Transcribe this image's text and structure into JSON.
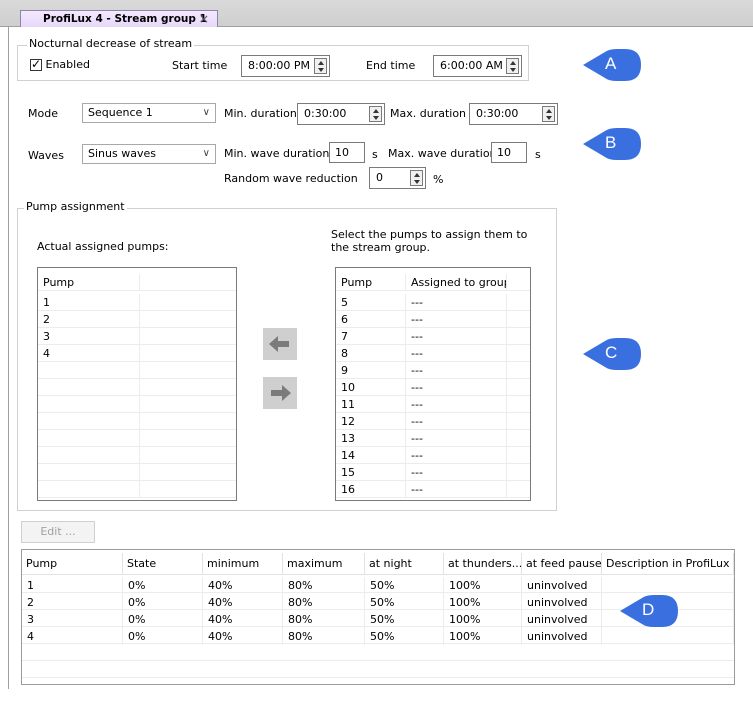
{
  "tab": {
    "title": "ProfiLux 4 - Stream group 1",
    "close": "×"
  },
  "nocturnal": {
    "legend": "Nocturnal decrease of stream",
    "enabled_label": "Enabled",
    "start_label": "Start time",
    "start_value": "8:00:00 PM",
    "end_label": "End time",
    "end_value": "6:00:00 AM"
  },
  "mode": {
    "label": "Mode",
    "value": "Sequence 1",
    "min_label": "Min. duration",
    "min_value": "0:30:00",
    "max_label": "Max. duration",
    "max_value": "0:30:00"
  },
  "waves": {
    "label": "Waves",
    "value": "Sinus waves",
    "min_label": "Min. wave duration",
    "min_value": "10",
    "min_unit": "s",
    "max_label": "Max. wave duration",
    "max_value": "10",
    "max_unit": "s",
    "random_label": "Random wave reduction",
    "random_value": "0",
    "random_unit": "%"
  },
  "pump_assignment": {
    "legend": "Pump assignment",
    "assigned_label": "Actual assigned pumps:",
    "select_label": "Select the pumps to assign them to the stream group.",
    "assigned_header": "Pump",
    "assigned": [
      "1",
      "2",
      "3",
      "4"
    ],
    "available_headers": [
      "Pump",
      "Assigned to group"
    ],
    "available": [
      [
        "5",
        "---"
      ],
      [
        "6",
        "---"
      ],
      [
        "7",
        "---"
      ],
      [
        "8",
        "---"
      ],
      [
        "9",
        "---"
      ],
      [
        "10",
        "---"
      ],
      [
        "11",
        "---"
      ],
      [
        "12",
        "---"
      ],
      [
        "13",
        "---"
      ],
      [
        "14",
        "---"
      ],
      [
        "15",
        "---"
      ],
      [
        "16",
        "---"
      ]
    ]
  },
  "edit_button": "Edit ...",
  "table": {
    "headers": [
      "Pump",
      "State",
      "minimum",
      "maximum",
      "at night",
      "at thunders...",
      "at feed pause",
      "Description in ProfiLux"
    ],
    "rows": [
      [
        "1",
        "0%",
        "40%",
        "80%",
        "50%",
        "100%",
        "uninvolved",
        ""
      ],
      [
        "2",
        "0%",
        "40%",
        "80%",
        "50%",
        "100%",
        "uninvolved",
        ""
      ],
      [
        "3",
        "0%",
        "40%",
        "80%",
        "50%",
        "100%",
        "uninvolved",
        ""
      ],
      [
        "4",
        "0%",
        "40%",
        "80%",
        "50%",
        "100%",
        "uninvolved",
        ""
      ]
    ]
  },
  "callouts": [
    "A",
    "B",
    "C",
    "D"
  ],
  "colors": {
    "callout": "#3a6fe0",
    "tab": "#e6d6f8",
    "arrow_button": "#cfcfcf"
  }
}
